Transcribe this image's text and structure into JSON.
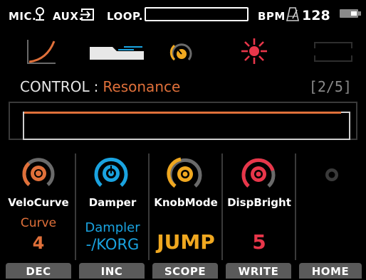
{
  "status": {
    "mic_label": "MIC.",
    "aux_label": "AUX.",
    "loop_label": "LOOP.",
    "bpm_label": "BPM",
    "bpm_value": "128",
    "icons": [
      "microphone-icon",
      "aux-input-icon",
      "metronome-icon",
      "battery-icon"
    ]
  },
  "modes": {
    "icons": [
      "velocity-curve-icon",
      "damper-pedal-icon",
      "knob-mode-icon",
      "brightness-icon",
      "empty-slot-icon"
    ]
  },
  "control": {
    "label": "CONTROL",
    "separator": ":",
    "parameter": "Resonance",
    "page": "[2/5]",
    "level": 0.95
  },
  "knobs": [
    {
      "name": "VeloCurve",
      "value_label": "Curve",
      "value": "4",
      "color": "#e0703a"
    },
    {
      "name": "Damper",
      "value_label": "Dampler",
      "value": "-/KORG",
      "color": "#1aa3e0"
    },
    {
      "name": "KnobMode",
      "value_label": "",
      "value": "JUMP",
      "color": "#f0a820"
    },
    {
      "name": "DispBright",
      "value_label": "",
      "value": "5",
      "color": "#e8364a"
    }
  ],
  "function_buttons": [
    "DEC",
    "INC",
    "SCOPE",
    "WRITE",
    "HOME"
  ],
  "colors": {
    "accent_orange": "#e0703a",
    "accent_blue": "#1aa3e0",
    "accent_yellow": "#f0a820",
    "accent_red": "#e8364a",
    "button_gray": "#5a5a5a"
  }
}
